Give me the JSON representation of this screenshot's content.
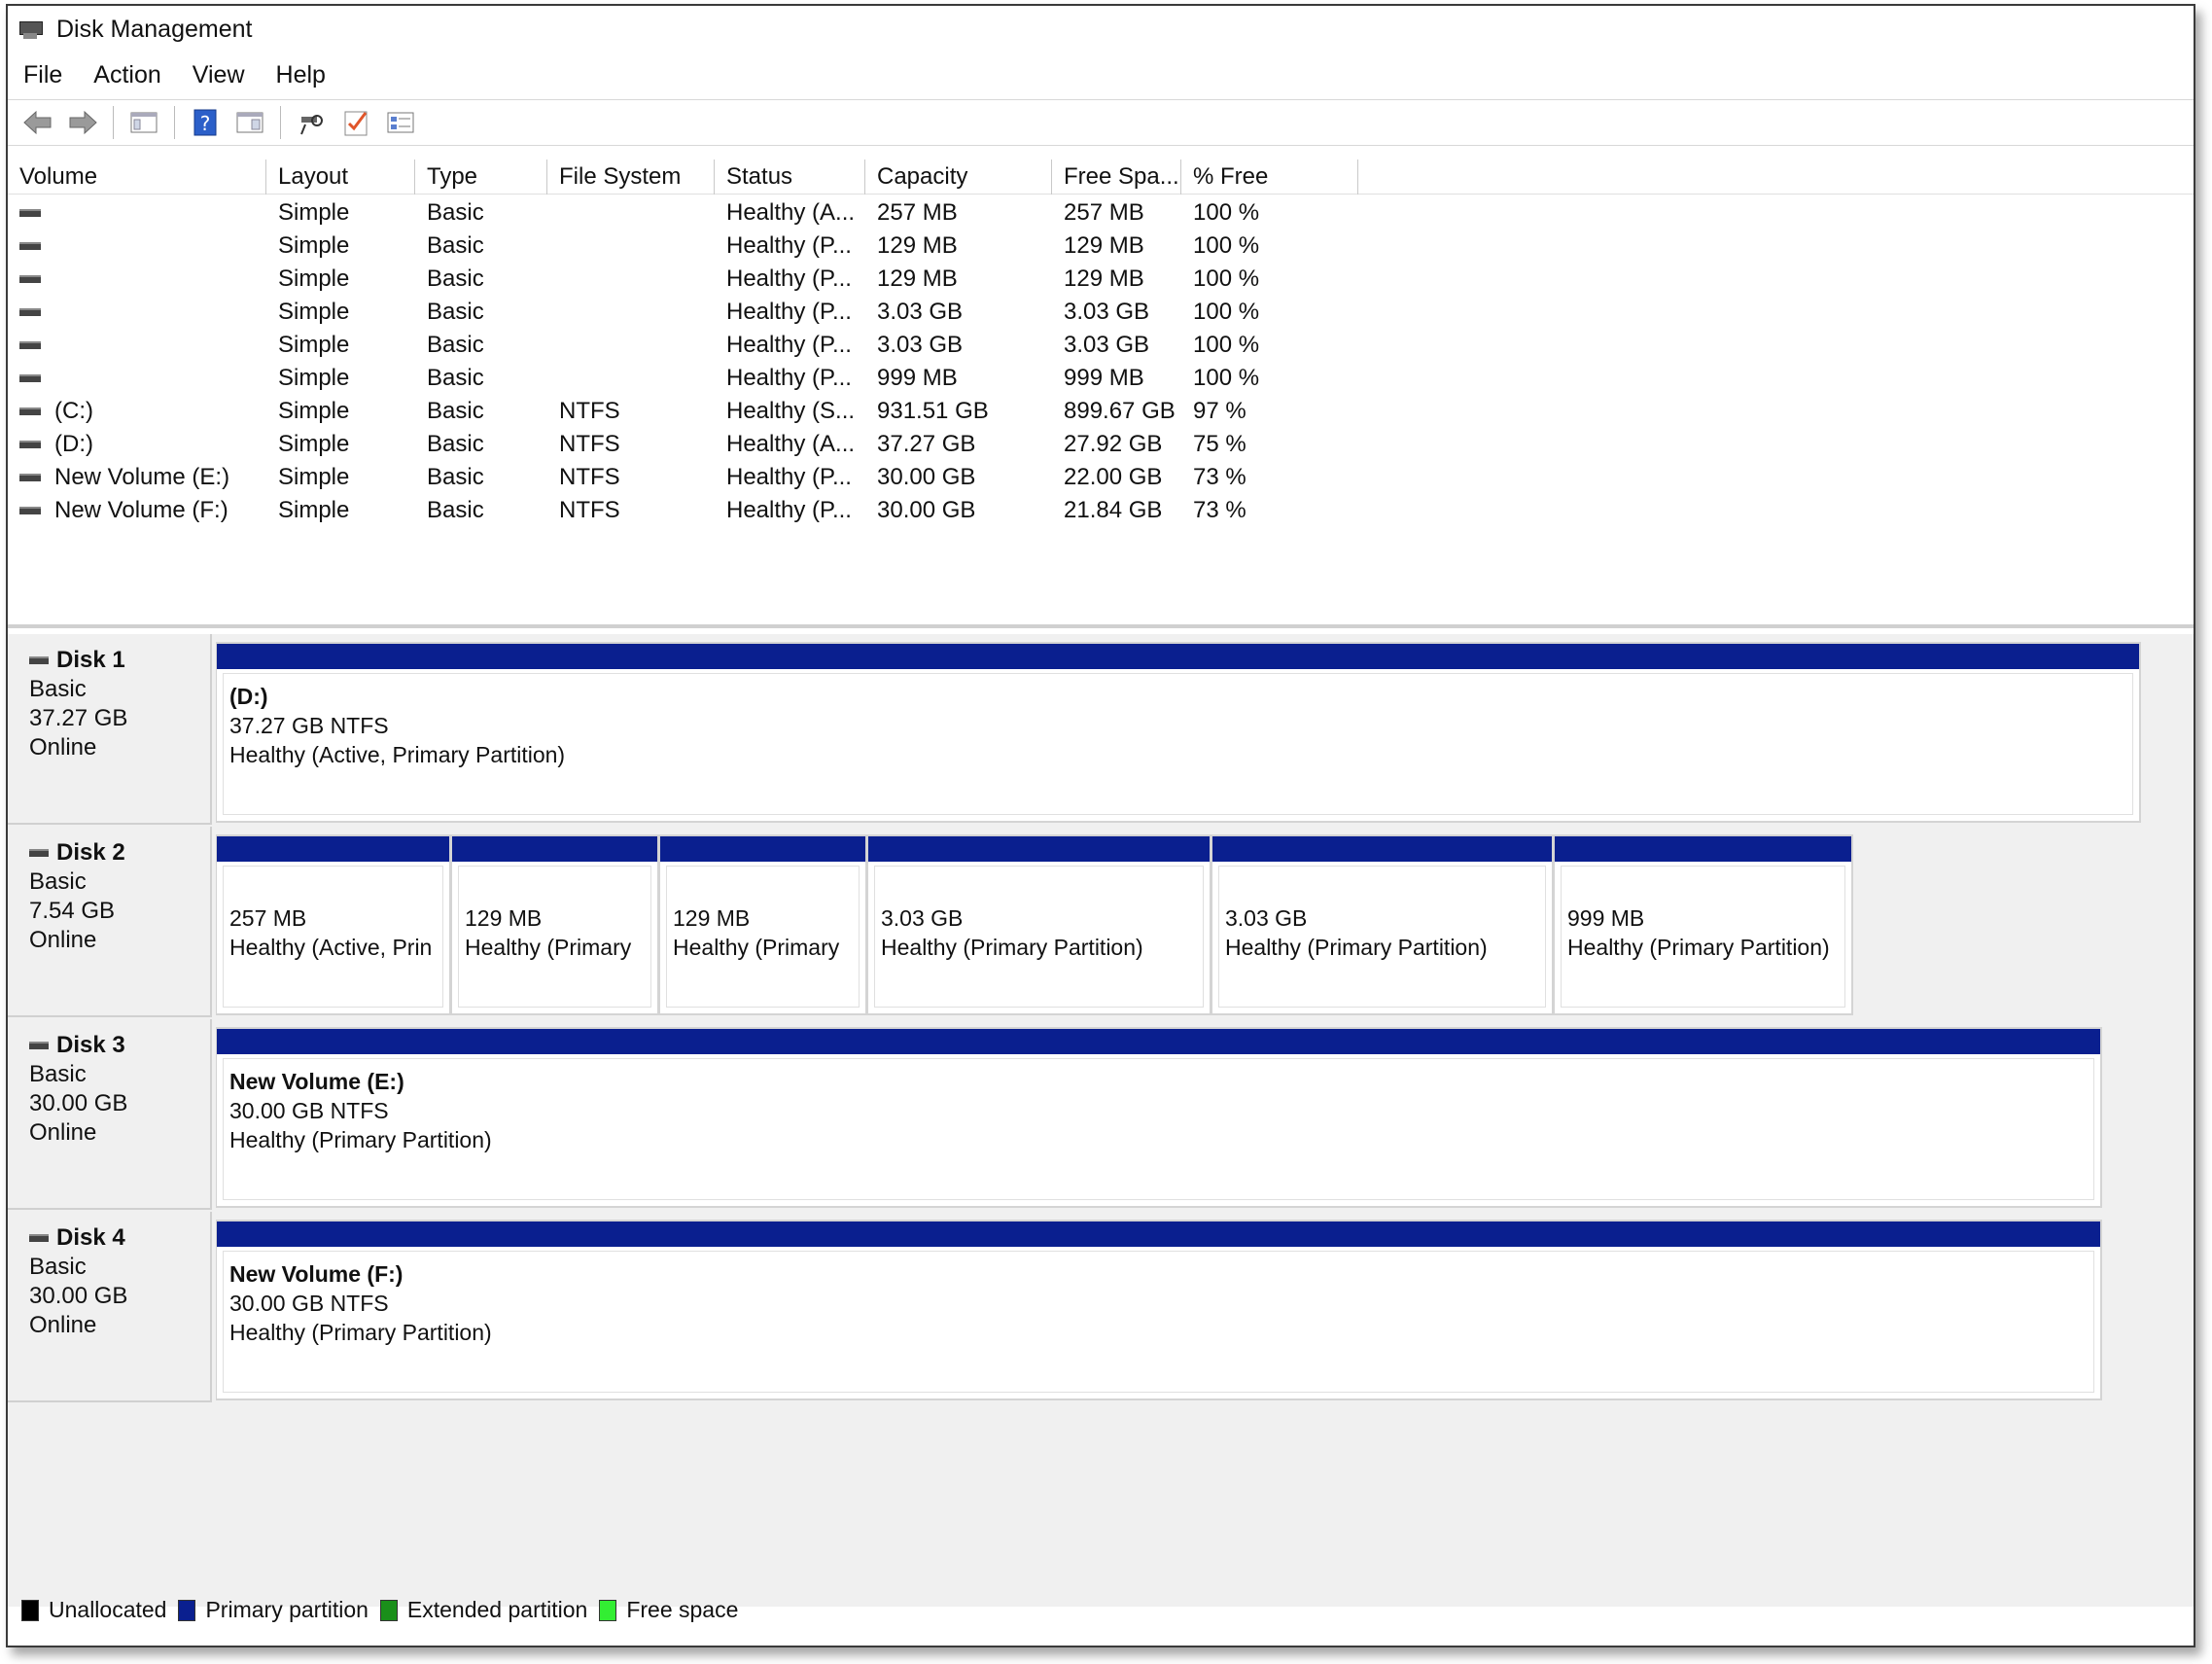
{
  "window": {
    "title": "Disk Management"
  },
  "menu": [
    "File",
    "Action",
    "View",
    "Help"
  ],
  "toolbar": [
    {
      "name": "back-icon",
      "glyph": "⇦"
    },
    {
      "name": "forward-icon",
      "glyph": "⇨"
    },
    {
      "name": "console-tree-icon"
    },
    {
      "name": "help-icon"
    },
    {
      "name": "properties-icon"
    },
    {
      "name": "rescan-disks-icon"
    },
    {
      "name": "check-icon"
    },
    {
      "name": "list-view-icon"
    }
  ],
  "table": {
    "columns": [
      "Volume",
      "Layout",
      "Type",
      "File System",
      "Status",
      "Capacity",
      "Free Spa...",
      "% Free"
    ],
    "rows": [
      [
        "",
        "Simple",
        "Basic",
        "",
        "Healthy (A...",
        "257 MB",
        "257 MB",
        "100 %"
      ],
      [
        "",
        "Simple",
        "Basic",
        "",
        "Healthy (P...",
        "129 MB",
        "129 MB",
        "100 %"
      ],
      [
        "",
        "Simple",
        "Basic",
        "",
        "Healthy (P...",
        "129 MB",
        "129 MB",
        "100 %"
      ],
      [
        "",
        "Simple",
        "Basic",
        "",
        "Healthy (P...",
        "3.03 GB",
        "3.03 GB",
        "100 %"
      ],
      [
        "",
        "Simple",
        "Basic",
        "",
        "Healthy (P...",
        "3.03 GB",
        "3.03 GB",
        "100 %"
      ],
      [
        "",
        "Simple",
        "Basic",
        "",
        "Healthy (P...",
        "999 MB",
        "999 MB",
        "100 %"
      ],
      [
        "(C:)",
        "Simple",
        "Basic",
        "NTFS",
        "Healthy (S...",
        "931.51 GB",
        "899.67 GB",
        "97 %"
      ],
      [
        "(D:)",
        "Simple",
        "Basic",
        "NTFS",
        "Healthy (A...",
        "37.27 GB",
        "27.92 GB",
        "75 %"
      ],
      [
        "New Volume (E:)",
        "Simple",
        "Basic",
        "NTFS",
        "Healthy (P...",
        "30.00 GB",
        "22.00 GB",
        "73 %"
      ],
      [
        "New Volume (F:)",
        "Simple",
        "Basic",
        "NTFS",
        "Healthy (P...",
        "30.00 GB",
        "21.84 GB",
        "73 %"
      ]
    ]
  },
  "disks": [
    {
      "name": "Disk 1",
      "type": "Basic",
      "size": "37.27 GB",
      "state": "Online",
      "partitions": [
        {
          "name": "(D:)",
          "line1": "37.27 GB NTFS",
          "line2": "Healthy (Active, Primary Partition)"
        }
      ]
    },
    {
      "name": "Disk 2",
      "type": "Basic",
      "size": "7.54 GB",
      "state": "Online",
      "partitions": [
        {
          "name": "",
          "line1": "257 MB",
          "line2": "Healthy (Active, Prin"
        },
        {
          "name": "",
          "line1": "129 MB",
          "line2": "Healthy (Primary"
        },
        {
          "name": "",
          "line1": "129 MB",
          "line2": "Healthy (Primary"
        },
        {
          "name": "",
          "line1": "3.03 GB",
          "line2": "Healthy (Primary Partition)"
        },
        {
          "name": "",
          "line1": "3.03 GB",
          "line2": "Healthy (Primary Partition)"
        },
        {
          "name": "",
          "line1": "999 MB",
          "line2": "Healthy (Primary Partition)"
        }
      ]
    },
    {
      "name": "Disk 3",
      "type": "Basic",
      "size": "30.00 GB",
      "state": "Online",
      "partitions": [
        {
          "name": "New Volume  (E:)",
          "line1": "30.00 GB NTFS",
          "line2": "Healthy (Primary Partition)"
        }
      ]
    },
    {
      "name": "Disk 4",
      "type": "Basic",
      "size": "30.00 GB",
      "state": "Online",
      "partitions": [
        {
          "name": "New Volume  (F:)",
          "line1": "30.00 GB NTFS",
          "line2": "Healthy (Primary Partition)"
        }
      ]
    }
  ],
  "legend": [
    {
      "label": "Unallocated",
      "color": "#000000"
    },
    {
      "label": "Primary partition",
      "color": "#0a1f8f"
    },
    {
      "label": "Extended partition",
      "color": "#1a8f1a"
    },
    {
      "label": "Free space",
      "color": "#33ee33"
    }
  ],
  "colors": {
    "partition_bar": "#0a1f8f"
  }
}
